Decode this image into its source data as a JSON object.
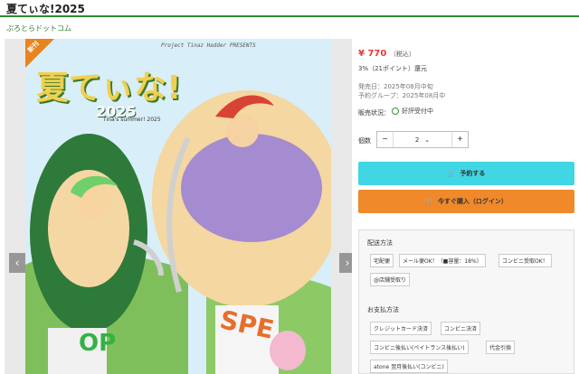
{
  "page": {
    "title": "夏てぃな!2025",
    "shop_link": "ぷろとらドットコム"
  },
  "gallery": {
    "badge": "新刊",
    "presents_text": "Project Tinaz Hadder PRESENTS",
    "logo_text": "夏てぃな!",
    "logo_year": "2025",
    "subtitle": "Tina's summer! 2025",
    "left_arrow": "‹",
    "right_arrow": "›",
    "banner_left": "OP",
    "banner_right": "SPE"
  },
  "product": {
    "price": "¥ 770",
    "price_tax": "（税込）",
    "points": "3%（21ポイント）還元",
    "release": "発売日：2025年08月中旬",
    "reserve_group": "予約グループ：2025年08月中",
    "status_label": "販売状況：",
    "status_value": "好評受付中",
    "qty_label": "個数",
    "qty_value": "2",
    "reserve_button": "予約する",
    "buy_button": "今すぐ購入（ログイン）"
  },
  "shipping": {
    "label": "配送方法",
    "tags": [
      "宅配便",
      "メール便OK！（■容量：18%）",
      "コンビニ受取OK！",
      "@店舗受取り"
    ]
  },
  "payment": {
    "label": "お支払方法",
    "tags": [
      "クレジットカード決済",
      "コンビニ決済",
      "コンビニ後払い(ペイトランス後払い)",
      "代金引換",
      "atone 翌月後払い(コンビニ)"
    ]
  },
  "colors": {
    "accent_green": "#2f8a2f",
    "price_red": "#e53935",
    "reserve_cyan": "#40d6e4",
    "buy_orange": "#f0892a"
  }
}
